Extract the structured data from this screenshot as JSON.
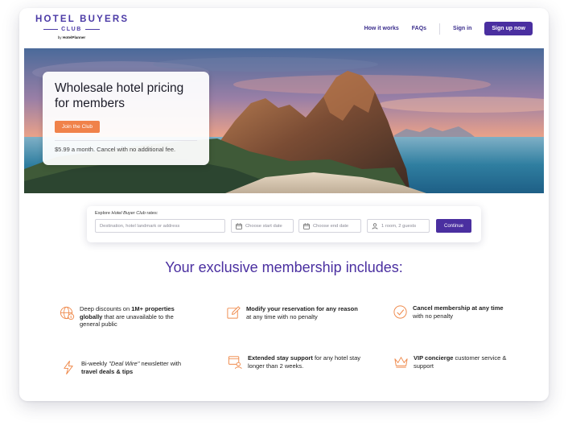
{
  "brand": {
    "name": "HOTEL BUYERS",
    "sub": "CLUB",
    "by_prefix": "by",
    "by_name": "HotelPlanner",
    "color": "#4b3aa6"
  },
  "nav": {
    "how_it_works": "How it works",
    "faqs": "FAQs",
    "sign_in": "Sign in",
    "sign_up": "Sign up now"
  },
  "hero": {
    "title": "Wholesale hotel pricing for members",
    "cta": "Join the Club",
    "note": "$5.99 a month. Cancel with no additional fee."
  },
  "search": {
    "label_prefix": "Explore",
    "label_italic": "Hotel Buyer Club",
    "label_suffix": "rates:",
    "destination_placeholder": "Destination, hotel landmark or address",
    "start_placeholder": "Choose start date",
    "end_placeholder": "Choose end date",
    "guests_value": "1 room, 2 guests",
    "continue": "Continue"
  },
  "membership": {
    "title": "Your exclusive membership includes:",
    "f1_a": "Deep discounts on ",
    "f1_b": "1M+ properties globally",
    "f1_c": " that are unavailable to the general public",
    "f2_a": "Modify your reservation for any reason",
    "f2_b": " at any time with no penalty",
    "f3_a": "Cancel membership at any time",
    "f3_b": "with no penalty",
    "f4_a": "Bi-weekly ",
    "f4_b": "\"Deal Wire\"",
    "f4_c": " newsletter with ",
    "f4_d": "travel deals & tips",
    "f5_a": "Extended stay support",
    "f5_b": " for any hotel stay longer than 2 weeks.",
    "f6_a": "VIP concierge",
    "f6_b": " customer service & support"
  },
  "colors": {
    "accent": "#4a2fa0",
    "orange": "#f0824a",
    "icon": "#ef8a4c"
  },
  "icons": [
    "globe-dollar-icon",
    "edit-icon",
    "check-circle-icon",
    "lightning-icon",
    "calendar-person-icon",
    "crown-icon",
    "calendar-icon",
    "person-icon"
  ]
}
